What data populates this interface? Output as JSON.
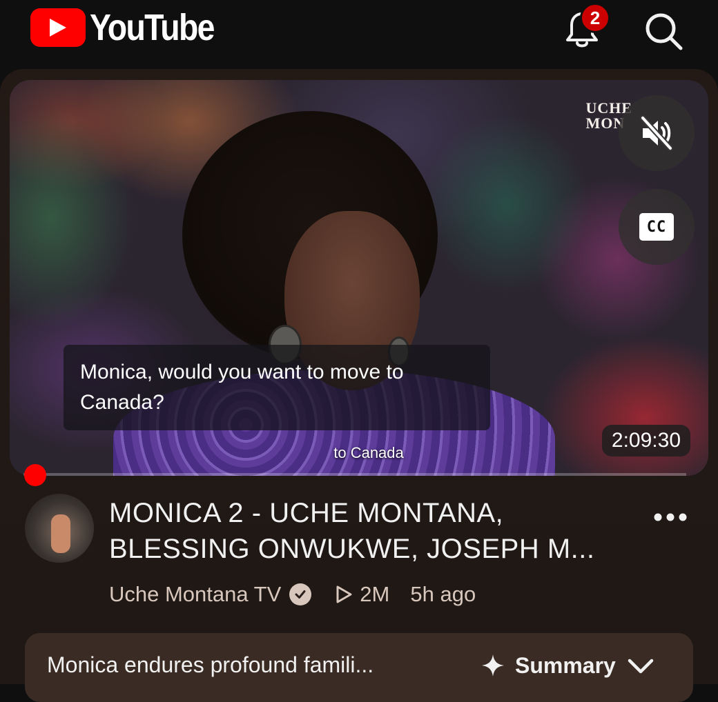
{
  "header": {
    "logo_text": "YouTube",
    "notification_count": "2",
    "brand_color": "#ff0000"
  },
  "player": {
    "channel_watermark_line1": "UCHE",
    "channel_watermark_line2": "MON",
    "caption_text": "Monica, would you want to move to Canada?",
    "burned_caption": "to Canada",
    "duration": "2:09:30",
    "muted": true,
    "cc_label": "CC",
    "progress": 0
  },
  "video": {
    "title": "MONICA 2 - UCHE MONTANA, BLESSING ONWUKWE, JOSEPH M...",
    "channel": "Uche Montana TV",
    "verified": true,
    "views": "2M",
    "age": "5h ago"
  },
  "summary": {
    "text": "Monica endures profound famili...",
    "button_label": "Summary"
  },
  "icons": {
    "logo": "youtube-play-icon",
    "bell": "bell-icon",
    "search": "search-icon",
    "mute": "volume-muted-icon",
    "cc": "closed-captions-icon",
    "more": "more-vertical-icon",
    "verified": "verified-check-icon",
    "views": "play-outline-icon",
    "sparkle": "sparkle-icon",
    "chevron": "chevron-down-icon"
  }
}
